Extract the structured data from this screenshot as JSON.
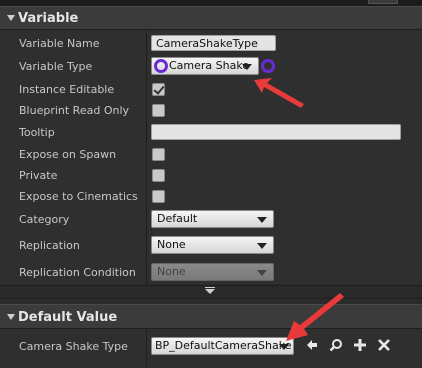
{
  "variable_section": {
    "title": "Variable",
    "rows": {
      "variable_name": {
        "label": "Variable Name",
        "value": "CameraShakeType"
      },
      "variable_type": {
        "label": "Variable Type",
        "value": "Camera Shake"
      },
      "instance_editable": {
        "label": "Instance Editable",
        "checked": true
      },
      "blueprint_read_only": {
        "label": "Blueprint Read Only",
        "checked": false
      },
      "tooltip": {
        "label": "Tooltip",
        "value": ""
      },
      "expose_on_spawn": {
        "label": "Expose on Spawn",
        "checked": false
      },
      "private": {
        "label": "Private",
        "checked": false
      },
      "expose_to_cinematics": {
        "label": "Expose to Cinematics",
        "checked": false
      },
      "category": {
        "label": "Category",
        "value": "Default"
      },
      "replication": {
        "label": "Replication",
        "value": "None"
      },
      "replication_condition": {
        "label": "Replication Condition",
        "value": "None"
      }
    }
  },
  "default_value_section": {
    "title": "Default Value",
    "camera_shake_type": {
      "label": "Camera Shake Type",
      "value": "BP_DefaultCameraShake"
    }
  },
  "icons": {
    "back": "arrow-left-icon",
    "browse": "magnifier-icon",
    "add": "plus-icon",
    "clear": "x-icon"
  },
  "colors": {
    "pin": "#6a2bd6",
    "annotation_arrow": "#e83a3a"
  }
}
